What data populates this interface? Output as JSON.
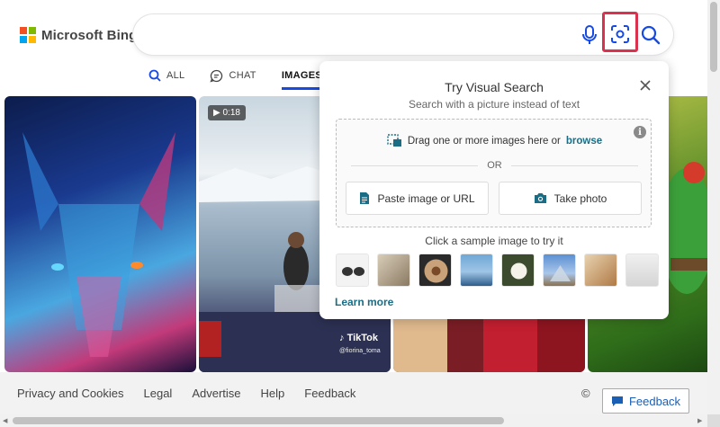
{
  "brand": {
    "name": "Microsoft Bing",
    "colors": [
      "#f25022",
      "#7fba00",
      "#00a4ef",
      "#ffb900"
    ]
  },
  "search": {
    "value": "",
    "placeholder": ""
  },
  "tabs": [
    {
      "label": "ALL",
      "icon": "search-icon"
    },
    {
      "label": "CHAT",
      "icon": "chat-icon"
    },
    {
      "label": "IMAGES",
      "icon": "",
      "active": true
    }
  ],
  "images": {
    "video_duration": "0:18",
    "tiktok_label": "TikTok",
    "tiktok_user": "@fiorina_toma"
  },
  "visual_search": {
    "title": "Try Visual Search",
    "subtitle": "Search with a picture instead of text",
    "drag_text": "Drag one or more images here or",
    "browse_label": "browse",
    "or_label": "OR",
    "paste_label": "Paste image or URL",
    "photo_label": "Take photo",
    "sample_label": "Click a sample image to try it",
    "learn_more": "Learn more",
    "accent": "#1b6d85"
  },
  "footer": {
    "links": [
      "Privacy and Cookies",
      "Legal",
      "Advertise",
      "Help",
      "Feedback"
    ],
    "copyright": "©",
    "feedback_button": "Feedback"
  }
}
